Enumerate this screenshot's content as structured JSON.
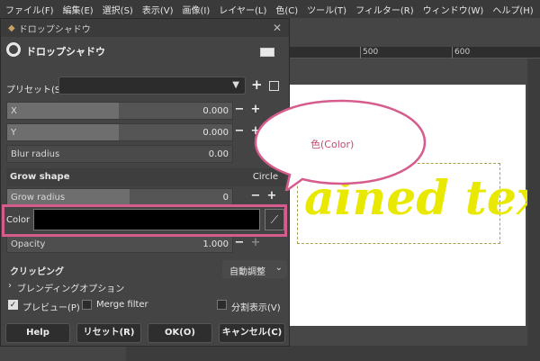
{
  "menubar": {
    "items": [
      "ファイル(F)",
      "編集(E)",
      "選択(S)",
      "表示(V)",
      "画像(I)",
      "レイヤー(L)",
      "色(C)",
      "ツール(T)",
      "フィルター(R)",
      "ウィンドウ(W)",
      "ヘルプ(H)"
    ]
  },
  "ruler": {
    "label_500": "500",
    "label_600": "600"
  },
  "canvas": {
    "text": "ained text",
    "text_color": "#e8e800"
  },
  "dialog": {
    "window_title": "ドロップシャドウ",
    "name": "ドロップシャドウ",
    "preset_label": "プリセット(S):",
    "preset_value": "",
    "x": {
      "label": "X",
      "value": "0.000"
    },
    "y": {
      "label": "Y",
      "value": "0.000"
    },
    "blur": {
      "label": "Blur radius",
      "value": "0.00"
    },
    "grow_shape": {
      "label": "Grow shape",
      "value": "Circle"
    },
    "grow_radius": {
      "label": "Grow radius",
      "value": "0"
    },
    "color": {
      "label": "Color",
      "value": "#000000"
    },
    "opacity": {
      "label": "Opacity",
      "value": "1.000"
    },
    "clipping": {
      "label": "クリッピング",
      "value": "自動調整"
    },
    "blending": {
      "label": "ブレンディングオプション"
    },
    "preview": {
      "label": "プレビュー(P)",
      "checked": true
    },
    "merge": {
      "label": "Merge filter",
      "checked": false
    },
    "split": {
      "label": "分割表示(V)",
      "checked": false
    },
    "buttons": {
      "help": "Help",
      "reset": "リセット(R)",
      "ok": "OK(O)",
      "cancel": "キャンセル(C)"
    }
  },
  "callout": {
    "text": "色(Color)",
    "border_color": "#d65c8e"
  }
}
